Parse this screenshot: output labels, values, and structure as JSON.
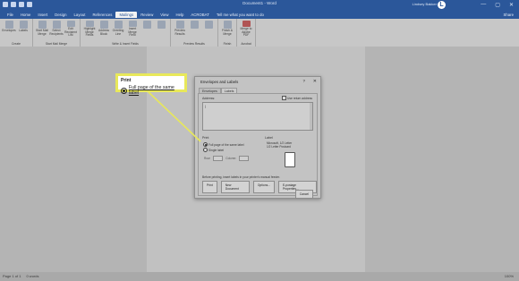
{
  "window": {
    "title": "Document1 - Word",
    "user": "Lindsey Bakker",
    "avatar_letter": "L",
    "share": "Share"
  },
  "window_buttons": [
    "—",
    "▢",
    "✕"
  ],
  "tabs": [
    "File",
    "Home",
    "Insert",
    "Design",
    "Layout",
    "References",
    "Mailings",
    "Review",
    "View",
    "Help",
    "ACROBAT"
  ],
  "active_tab": "Mailings",
  "tell_me": "Tell me what you want to do",
  "ribbon": {
    "groups": [
      {
        "name": "Create",
        "buttons": [
          "Envelopes",
          "Labels"
        ]
      },
      {
        "name": "Start Mail Merge",
        "buttons": [
          "Start Mail Merge",
          "Select Recipients",
          "Edit Recipient List"
        ]
      },
      {
        "name": "Write & Insert Fields",
        "buttons": [
          "Highlight Merge Fields",
          "Address Block",
          "Greeting Line",
          "Insert Merge Field"
        ]
      },
      {
        "name": "Preview Results",
        "buttons": [
          "Preview Results"
        ]
      },
      {
        "name": "Finish",
        "buttons": [
          "Finish & Merge"
        ]
      },
      {
        "name": "Acrobat",
        "buttons": [
          "Merge to Adobe PDF"
        ]
      }
    ]
  },
  "statusbar": {
    "page": "Page 1 of 1",
    "words": "0 words",
    "zoom": "100%"
  },
  "dialog": {
    "title": "Envelopes and Labels",
    "help": "?",
    "close": "✕",
    "tabs": [
      "Envelopes",
      "Labels"
    ],
    "active_tab": "Labels",
    "address_label": "Address:",
    "use_return_address": "Use return address",
    "cursor_text": "|",
    "print_label": "Print",
    "full_page": "Full page of the same label",
    "single_label": "Single label",
    "row_label": "Row:",
    "column_label": "Column:",
    "label_title": "Label",
    "label_vendor": "Microsoft, 1/2 Letter",
    "label_type": "1/2 Letter Postcard",
    "note": "Before printing, insert labels in your printer's manual feeder.",
    "buttons": [
      "Print",
      "New Document",
      "Options...",
      "E-postage Properties..."
    ],
    "cancel": "Cancel"
  },
  "callout": {
    "title": "Print",
    "option": "Full page of the same label"
  },
  "colors": {
    "accent": "#2b579a",
    "highlight": "#e8e85a"
  }
}
